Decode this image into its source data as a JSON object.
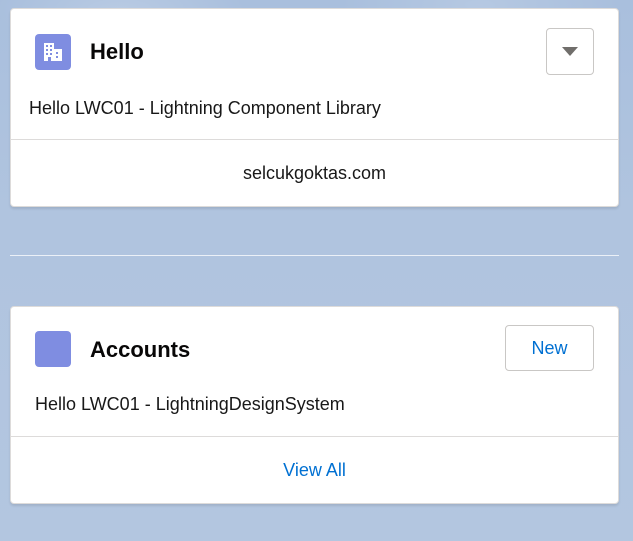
{
  "hello_card": {
    "title": "Hello",
    "icon": "building-icon",
    "body_text": "Hello LWC01 - Lightning Component Library",
    "footer_text": "selcukgoktas.com",
    "menu_icon": "chevron-down-icon"
  },
  "accounts_card": {
    "title": "Accounts",
    "icon": "account-icon",
    "new_button_label": "New",
    "body_text": "Hello LWC01 - LightningDesignSystem",
    "footer_link": "View All"
  },
  "colors": {
    "icon_tile": "#7f8de1",
    "link": "#0070d2",
    "background": "#b0c4df"
  }
}
